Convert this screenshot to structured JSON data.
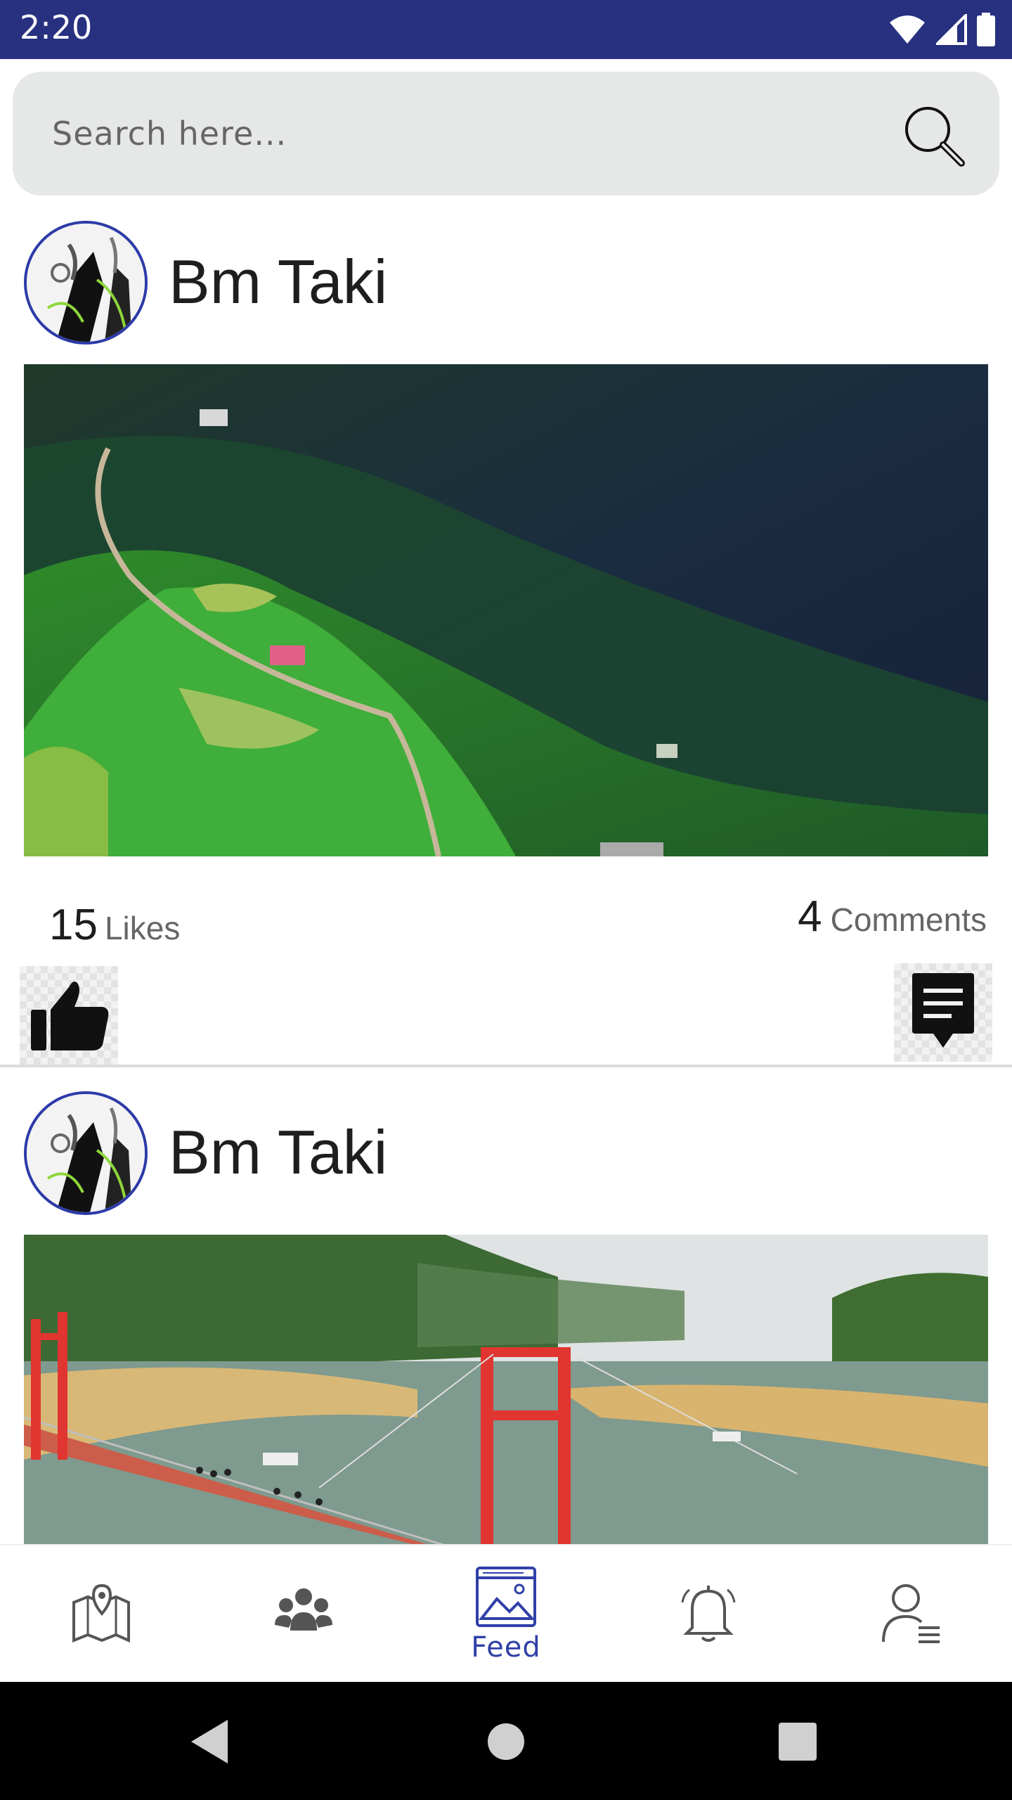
{
  "status_bar": {
    "time": "2:20",
    "color": "#283080"
  },
  "search": {
    "placeholder": "Search here...",
    "value": "",
    "icon": "search-icon"
  },
  "posts": [
    {
      "author": "Bm Taki",
      "image": "forested-hills-landscape",
      "likes_count": "15",
      "likes_label": "Likes",
      "comments_count": "4",
      "comments_label": "Comments"
    },
    {
      "author": "Bm Taki",
      "image": "lake-suspension-bridge"
    }
  ],
  "bottom_nav": {
    "items": [
      {
        "icon": "map-icon",
        "label": ""
      },
      {
        "icon": "group-icon",
        "label": ""
      },
      {
        "icon": "feed-icon",
        "label": "Feed",
        "active": true
      },
      {
        "icon": "bell-icon",
        "label": ""
      },
      {
        "icon": "profile-icon",
        "label": ""
      }
    ],
    "active_color": "#3040a8"
  },
  "system_nav": {
    "buttons": [
      "back-icon",
      "home-icon",
      "recents-icon"
    ]
  }
}
